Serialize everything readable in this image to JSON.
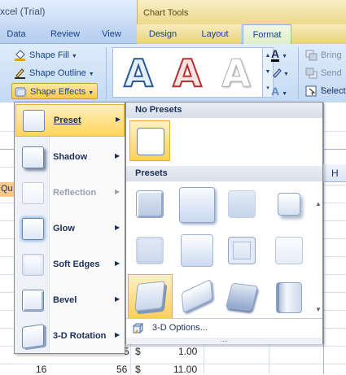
{
  "window": {
    "title_fragment": "xcel (Trial)",
    "context_tab_group": "Chart Tools"
  },
  "tabs": [
    {
      "label": "Data"
    },
    {
      "label": "Review"
    },
    {
      "label": "View"
    },
    {
      "label": "Design"
    },
    {
      "label": "Layout"
    },
    {
      "label": "Format"
    }
  ],
  "ribbon": {
    "shape_fill": "Shape Fill",
    "shape_outline": "Shape Outline",
    "shape_effects": "Shape Effects",
    "wordart_letter": "A",
    "bring": "Bring",
    "send": "Send t",
    "select": "Select"
  },
  "menu": {
    "items": [
      {
        "label": "Preset",
        "selected": true,
        "disabled": false,
        "icon": "preset-effect-icon"
      },
      {
        "label": "Shadow",
        "selected": false,
        "disabled": false,
        "icon": "shadow-effect-icon"
      },
      {
        "label": "Reflection",
        "selected": false,
        "disabled": true,
        "icon": "reflection-effect-icon"
      },
      {
        "label": "Glow",
        "selected": false,
        "disabled": false,
        "icon": "glow-effect-icon"
      },
      {
        "label": "Soft Edges",
        "selected": false,
        "disabled": false,
        "icon": "soft-edges-effect-icon"
      },
      {
        "label": "Bevel",
        "selected": false,
        "disabled": false,
        "icon": "bevel-effect-icon"
      },
      {
        "label": "3-D Rotation",
        "selected": false,
        "disabled": false,
        "icon": "3d-rotation-effect-icon"
      }
    ]
  },
  "panel": {
    "no_presets_header": "No Presets",
    "presets_header": "Presets",
    "options_label": "3-D Options...",
    "options_icon": "3d-options-icon"
  },
  "sheet": {
    "column_header": "H",
    "row_fragment": "Qu",
    "rows": [
      {
        "a": "",
        "b": "5",
        "currency": "$",
        "amount": "1.00"
      },
      {
        "a": "16",
        "b": "56",
        "currency": "$",
        "amount": "11.00"
      }
    ]
  },
  "colors": {
    "accent_selected": "#ffd45c",
    "ribbon_text": "#15428b",
    "context_tab": "#ecd98c"
  }
}
